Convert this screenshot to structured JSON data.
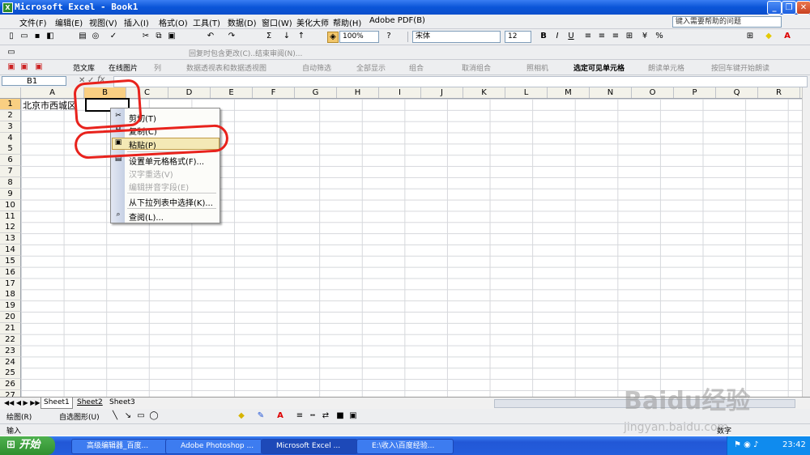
{
  "window": {
    "title": "Microsoft Excel - Book1",
    "app_icon": "excel-icon"
  },
  "menubar": {
    "items": [
      "文件(F)",
      "编辑(E)",
      "视图(V)",
      "插入(I)",
      "格式(O)",
      "工具(T)",
      "数据(D)",
      "窗口(W)",
      "美化大师",
      "帮助(H)",
      "Adobe PDF(B)"
    ],
    "help_placeholder": "键入需要帮助的问题"
  },
  "toolbar": {
    "zoom": "100%",
    "font_name": "宋体",
    "font_size": "12",
    "bold": "B",
    "italic": "I",
    "underline": "U",
    "percent": "%"
  },
  "reviewbar": {
    "reply_label": "回复时包含更改(C)...",
    "end_review_label": "结束审阅(N)..."
  },
  "extra_toolbar": {
    "items": [
      "范文库",
      "在线图片",
      "列",
      "数据透视表和数据透视图",
      "自动筛选",
      "全部显示",
      "组合",
      "取消组合",
      "照相机",
      "选定可见单元格",
      "朗读单元格",
      "按回车键开始朗读"
    ]
  },
  "formula_bar": {
    "name_box": "B1",
    "fx": "fx",
    "cancel": "✕",
    "enter": "✓"
  },
  "grid": {
    "columns": [
      "A",
      "B",
      "C",
      "D",
      "E",
      "F",
      "G",
      "H",
      "I",
      "J",
      "K",
      "L",
      "M",
      "N",
      "O",
      "P",
      "Q",
      "R"
    ],
    "rows": [
      "1",
      "2",
      "3",
      "4",
      "5",
      "6",
      "7",
      "8",
      "9",
      "10",
      "11",
      "12",
      "13",
      "14",
      "15",
      "16",
      "17",
      "18",
      "19",
      "20",
      "21",
      "22",
      "23",
      "24",
      "25",
      "26",
      "27"
    ],
    "selected_column": "B",
    "selected_row": "1",
    "cell_A1": "北京市西城区"
  },
  "context_menu": {
    "items": [
      {
        "label": "剪切(T)",
        "icon": "scissors-icon",
        "disabled": false
      },
      {
        "label": "复制(C)",
        "icon": "copy-icon",
        "disabled": false
      },
      {
        "label": "粘贴(P)",
        "icon": "paste-icon",
        "disabled": false,
        "highlighted": true
      },
      {
        "label": "设置单元格格式(F)...",
        "icon": "format-cells-icon",
        "disabled": false
      },
      {
        "label": "汉字重选(V)",
        "icon": "",
        "disabled": true
      },
      {
        "label": "编辑拼音字段(E)",
        "icon": "",
        "disabled": true
      },
      {
        "label": "从下拉列表中选择(K)...",
        "icon": "",
        "disabled": false
      },
      {
        "label": "查阅(L)...",
        "icon": "research-icon",
        "disabled": false
      }
    ]
  },
  "sheet_tabs": [
    "Sheet1",
    "Sheet2",
    "Sheet3"
  ],
  "drawbar": {
    "draw_label": "绘图(R)",
    "autoshape_label": "自选图形(U)"
  },
  "statusbar": {
    "mode": "输入",
    "num": "数字"
  },
  "taskbar": {
    "start": "开始",
    "tasks": [
      "高级编辑器_百度...",
      "Adobe Photoshop ...",
      "Microsoft Excel ...",
      "E:\\收入\\百度经验..."
    ],
    "active_task": 2,
    "clock": "23:42"
  },
  "watermark": {
    "brand": "Baidu经验",
    "url": "jingyan.baidu.com"
  },
  "colors": {
    "title_blue": "#0a55d8",
    "selection_header": "#f9cf82",
    "annotation_red": "#e8221c",
    "menu_highlight": "#f4e9b6"
  }
}
